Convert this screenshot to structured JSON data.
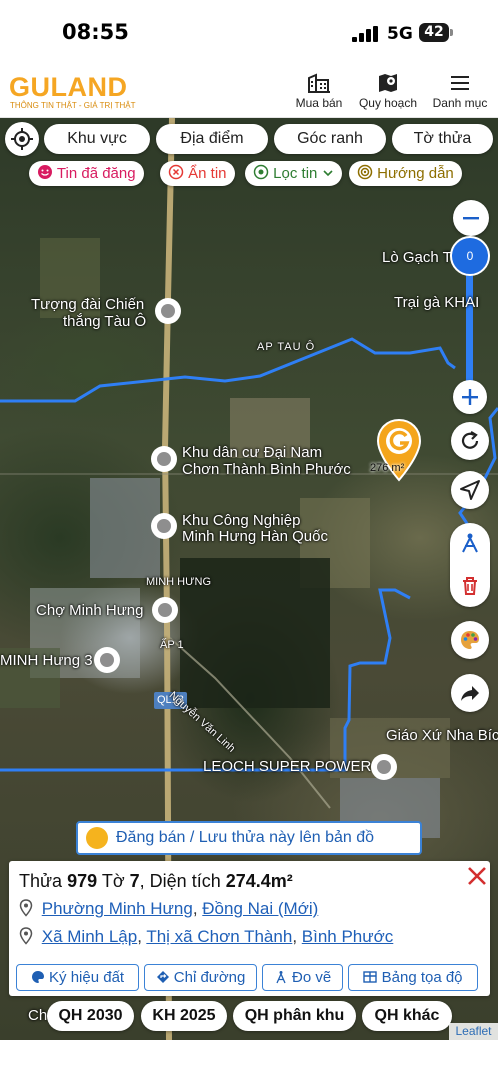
{
  "status_bar": {
    "time": "08:55",
    "network": "5G",
    "battery": "42"
  },
  "header": {
    "logo": "GULAND",
    "tagline": "THÔNG TIN THẬT - GIÁ TRỊ THẬT",
    "nav": [
      {
        "label": "Mua bán",
        "icon": "buildings-icon"
      },
      {
        "label": "Quy hoạch",
        "icon": "map-pin-icon"
      },
      {
        "label": "Danh mục",
        "icon": "menu-icon"
      }
    ]
  },
  "toolbar": {
    "tabs": [
      "Khu vực",
      "Địa điểm",
      "Góc ranh",
      "Tờ thửa"
    ],
    "filters": [
      {
        "label": "Tin đã đăng",
        "color": "#d81b60",
        "icon": "smile-icon"
      },
      {
        "label": "Ẩn tin",
        "color": "#e53935",
        "icon": "x-circle-icon"
      },
      {
        "label": "Lọc tin",
        "color": "#2e7d32",
        "icon": "location-icon"
      },
      {
        "label": "Hướng dẫn",
        "color": "#8d6e00",
        "icon": "target-icon"
      }
    ]
  },
  "map": {
    "labels": [
      "Tượng đài Chiến",
      "thắng Tàu Ô",
      "AP TAU Ô",
      "Lò Gạch T",
      "Trại gà KHAI",
      "Khu dân cư Đại Nam",
      "Chơn Thành Bình Phước",
      "Khu Công Nghiệp",
      "Minh Hưng Hàn Quốc",
      "MINH HƯNG",
      "Chợ Minh Hưng",
      "ẤP 1",
      "MINH Hưng 3",
      "QL13",
      "Nguyễn Văn Linh",
      "LEOCH SUPER POWER",
      "Giáo Xứ Nha Bíc",
      "Ch"
    ],
    "marker_area": "276 m²",
    "zoom_level": "0",
    "attribution": "Leaflet",
    "boundary_color": "#2f7ff5"
  },
  "save_banner": "Đăng bán / Lưu thửa này lên bản đồ",
  "parcel": {
    "prefix": "Thửa",
    "parcel_no": "979",
    "sheet_label": "Tờ",
    "sheet_no": "7",
    "area_label": ", Diện tích",
    "area": "274.4m²",
    "new_ward": "Phường Minh Hưng",
    "new_province": "Đồng Nai (Mới)",
    "old_commune": "Xã Minh Lập",
    "old_town": "Thị xã Chơn Thành",
    "old_province": "Bình Phước",
    "actions": [
      "Ký hiệu đất",
      "Chỉ đường",
      "Đo vẽ",
      "Bảng tọa độ"
    ]
  },
  "planning_chips": [
    "QH 2030",
    "KH 2025",
    "QH phân khu",
    "QH khác"
  ]
}
